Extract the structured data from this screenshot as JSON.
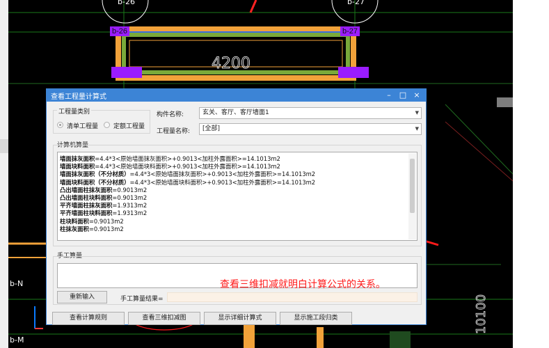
{
  "cad": {
    "tag_left_top": "b-26",
    "tag_right_top": "b-27",
    "top_circle_left": "b-26",
    "top_circle_right": "b-27",
    "dimension_4200": "4200",
    "label_bn": "b-N",
    "label_bm": "b-M",
    "dimension_10100": "10100"
  },
  "dialog": {
    "title": "查看工程量计算式",
    "category_group_label": "工程量类别",
    "radio_list": "清单工程量",
    "radio_quota": "定额工程量",
    "component_name_label": "构件名称:",
    "component_name_value": "玄关、客厅、客厅墙面1",
    "quantity_name_label": "工程量名称:",
    "quantity_name_value": "[全部]",
    "computer_calc_label": "计算机算量",
    "calc_lines": [
      {
        "name": "墙面抹灰面积",
        "formula": "=4.4*3<原始墙面抹灰面积>+0.9013<加柱外露面积>=14.1013m2"
      },
      {
        "name": "墙面块料面积",
        "formula": "=4.4*3<原始墙面块料面积>+0.9013<加柱外露面积>=14.1013m2"
      },
      {
        "name": "墙面抹灰面积（不分材质）",
        "formula": "=4.4*3<原始墙面抹灰面积>+0.9013<加柱外露面积>=14.1013m2"
      },
      {
        "name": "墙面块料面积（不分材质）",
        "formula": "=4.4*3<原始墙面块料面积>+0.9013<加柱外露面积>=14.1013m2"
      },
      {
        "name": "凸出墙面柱抹灰面积",
        "formula": "=0.9013m2"
      },
      {
        "name": "凸出墙面柱块料面积",
        "formula": "=0.9013m2"
      },
      {
        "name": "平齐墙面柱抹灰面积",
        "formula": "=1.9313m2"
      },
      {
        "name": "平齐墙面柱块料面积",
        "formula": "=1.9313m2"
      },
      {
        "name": "柱块料面积",
        "formula": "=0.9013m2"
      },
      {
        "name": "柱抹灰面积",
        "formula": "=0.9013m2"
      }
    ],
    "manual_calc_label": "手工算量",
    "reinput_button": "重新输入",
    "manual_result_label": "手工算量结果=",
    "btn_view_rule": "查看计算规则",
    "btn_view_3d": "查看三维扣减图",
    "btn_show_detail": "显示详细计算式",
    "btn_show_construction": "显示施工段归类"
  },
  "annotation": "查看三维扣减就明白计算公式的关系。",
  "colors": {
    "dialog_titlebar": "#3c84d6",
    "annotation": "#ff1a1a",
    "beam_orange": "#f2a23a",
    "beam_green": "#7aa93a",
    "tag_purple": "#9a1cff"
  }
}
